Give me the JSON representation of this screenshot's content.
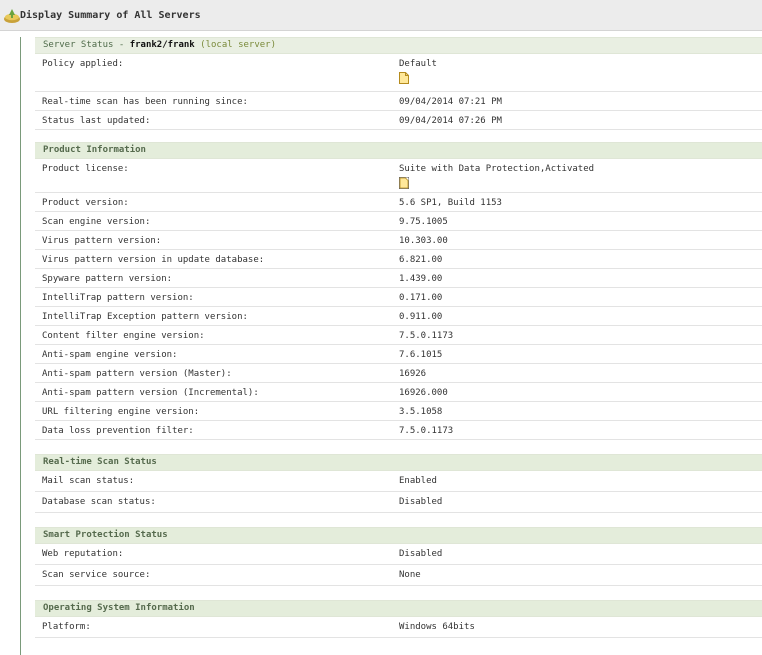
{
  "window": {
    "title": "Display Summary of All Servers",
    "title_icon": "servers-summary-icon"
  },
  "server_status": {
    "prefix": "Server Status - ",
    "server_name": "frank2/frank",
    "server_suffix": " (local server)",
    "rows": [
      {
        "label": "Policy applied:",
        "value": "Default",
        "icon": "document-icon"
      },
      {
        "label": "Real-time scan has been running since:",
        "value": "09/04/2014 07:21 PM"
      },
      {
        "label": "Status last updated:",
        "value": "09/04/2014 07:26 PM"
      }
    ]
  },
  "product_information": {
    "header": "Product Information",
    "rows": [
      {
        "label": "Product license:",
        "value": "Suite with Data Protection,Activated",
        "icon": "document-icon"
      },
      {
        "label": "Product version:",
        "value": "5.6 SP1, Build 1153"
      },
      {
        "label": "Scan engine version:",
        "value": "9.75.1005"
      },
      {
        "label": "Virus pattern version:",
        "value": "10.303.00"
      },
      {
        "label": "Virus pattern version in update database:",
        "value": "6.821.00"
      },
      {
        "label": "Spyware pattern version:",
        "value": "1.439.00"
      },
      {
        "label": "IntelliTrap pattern version:",
        "value": "0.171.00"
      },
      {
        "label": "IntelliTrap Exception pattern version:",
        "value": "0.911.00"
      },
      {
        "label": "Content filter engine version:",
        "value": "7.5.0.1173"
      },
      {
        "label": "Anti-spam engine version:",
        "value": "7.6.1015"
      },
      {
        "label": "Anti-spam pattern version (Master):",
        "value": "16926"
      },
      {
        "label": "Anti-spam pattern version (Incremental):",
        "value": "16926.000"
      },
      {
        "label": "URL filtering engine version:",
        "value": "3.5.1058"
      },
      {
        "label": "Data loss prevention filter:",
        "value": "7.5.0.1173"
      }
    ]
  },
  "realtime_scan_status": {
    "header": "Real-time Scan Status",
    "rows": [
      {
        "label": "Mail scan status:",
        "value": "Enabled"
      },
      {
        "label": "Database scan status:",
        "value": "Disabled"
      }
    ]
  },
  "smart_protection_status": {
    "header": "Smart Protection Status",
    "rows": [
      {
        "label": "Web reputation:",
        "value": "Disabled"
      },
      {
        "label": "Scan service source:",
        "value": "None"
      }
    ]
  },
  "os_information": {
    "header": "Operating System Information",
    "rows": [
      {
        "label": "Platform:",
        "value": "Windows 64bits"
      }
    ]
  }
}
